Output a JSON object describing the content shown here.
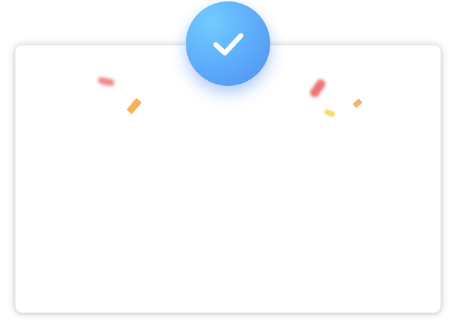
{
  "dialog": {
    "icon": "check-icon",
    "colors": {
      "badge_light": "#72ccff",
      "badge_dark": "#4f8ef1",
      "check": "#ffffff",
      "confetti_red": "#ee5f5f",
      "confetti_orange": "#f5b25a",
      "confetti_yellow": "#f8dc6c"
    }
  }
}
